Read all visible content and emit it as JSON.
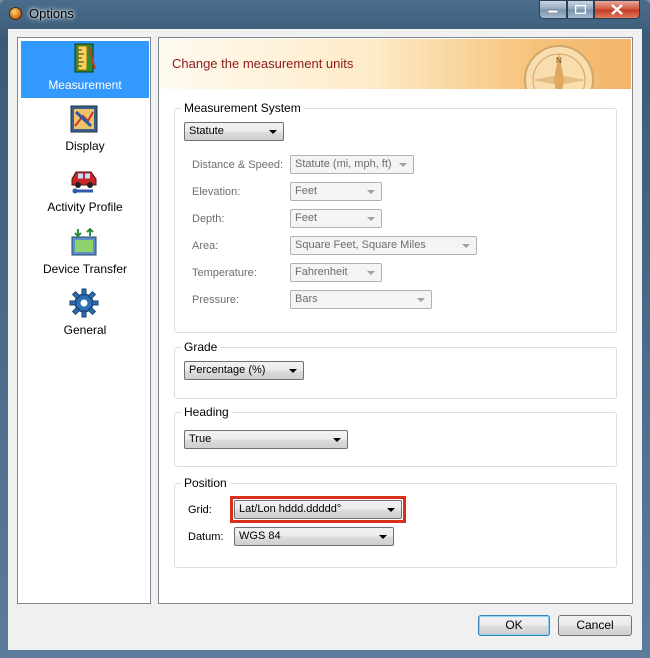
{
  "window": {
    "title": "Options"
  },
  "sidebar": {
    "items": [
      {
        "label": "Measurement",
        "icon": "ruler-icon",
        "active": true
      },
      {
        "label": "Display",
        "icon": "display-icon",
        "active": false
      },
      {
        "label": "Activity Profile",
        "icon": "car-icon",
        "active": false
      },
      {
        "label": "Device Transfer",
        "icon": "device-transfer-icon",
        "active": false
      },
      {
        "label": "General",
        "icon": "gear-icon",
        "active": false
      }
    ]
  },
  "banner": {
    "title": "Change the measurement units",
    "compass_letter": "N"
  },
  "measurement_system": {
    "label": "Measurement System",
    "value": "Statute",
    "rows": [
      {
        "label": "Distance & Speed:",
        "value": "Statute (mi, mph, ft)"
      },
      {
        "label": "Elevation:",
        "value": "Feet"
      },
      {
        "label": "Depth:",
        "value": "Feet"
      },
      {
        "label": "Area:",
        "value": "Square Feet, Square Miles"
      },
      {
        "label": "Temperature:",
        "value": "Fahrenheit"
      },
      {
        "label": "Pressure:",
        "value": "Bars"
      }
    ]
  },
  "grade": {
    "label": "Grade",
    "value": "Percentage (%)"
  },
  "heading": {
    "label": "Heading",
    "value": "True"
  },
  "position": {
    "label": "Position",
    "grid_label": "Grid:",
    "grid_value": "Lat/Lon hddd.ddddd°",
    "datum_label": "Datum:",
    "datum_value": "WGS 84"
  },
  "buttons": {
    "ok": "OK",
    "cancel": "Cancel"
  },
  "colors": {
    "accent": "#3399ff",
    "highlight": "#d9301c",
    "banner_title": "#8b1a1a"
  }
}
